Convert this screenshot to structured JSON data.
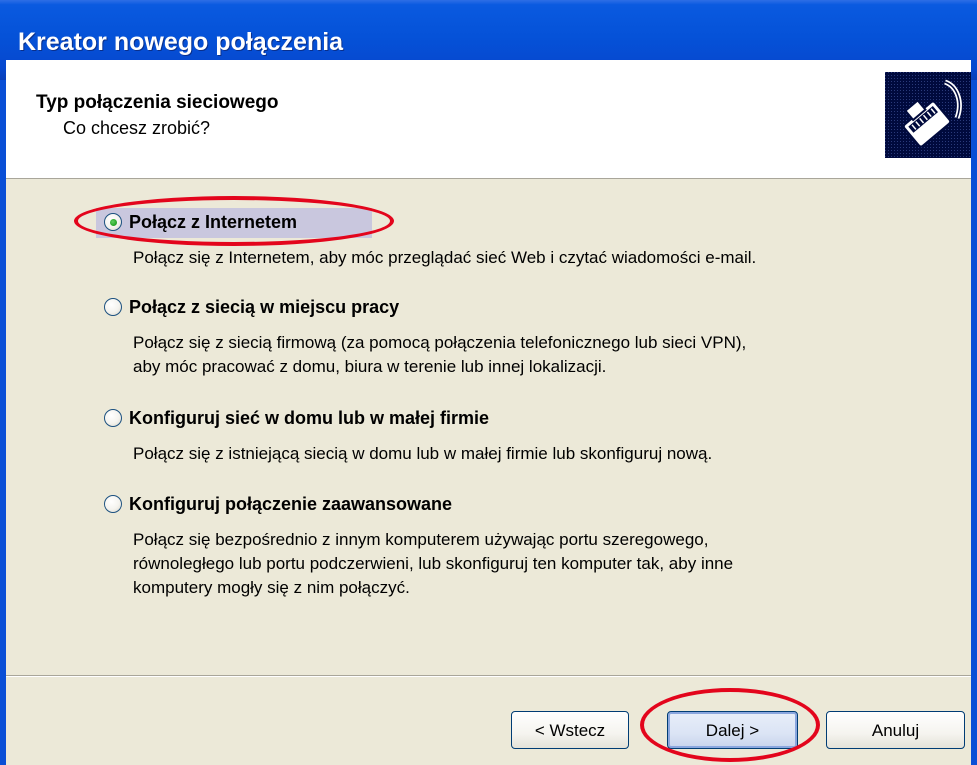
{
  "window": {
    "title": "Kreator nowego połączenia"
  },
  "header": {
    "title": "Typ połączenia sieciowego",
    "subtitle": "Co chcesz zrobić?",
    "icon": "network-cable-icon"
  },
  "options": [
    {
      "label": "Połącz z Internetem",
      "selected": true,
      "description": [
        "Połącz się z Internetem, aby móc przeglądać sieć Web i czytać wiadomości e-mail."
      ]
    },
    {
      "label": "Połącz z siecią w miejscu pracy",
      "selected": false,
      "description": [
        "Połącz się z siecią firmową (za pomocą połączenia telefonicznego lub sieci VPN),",
        "aby móc pracować z domu, biura w terenie lub innej lokalizacji."
      ]
    },
    {
      "label": "Konfiguruj sieć w domu lub w małej firmie",
      "selected": false,
      "description": [
        "Połącz się z istniejącą siecią w domu lub w małej firmie lub skonfiguruj nową."
      ]
    },
    {
      "label": "Konfiguruj połączenie zaawansowane",
      "selected": false,
      "description": [
        "Połącz się bezpośrednio z innym komputerem używając portu szeregowego,",
        "równoległego lub portu podczerwieni, lub skonfiguruj ten komputer tak, aby inne",
        "komputery mogły się z nim połączyć."
      ]
    }
  ],
  "buttons": {
    "back": "< Wstecz",
    "next": "Dalej >",
    "cancel": "Anuluj"
  },
  "colors": {
    "titlebar": "#0552d8",
    "highlight": "#e3051c",
    "dialog_bg": "#ece9d8"
  }
}
